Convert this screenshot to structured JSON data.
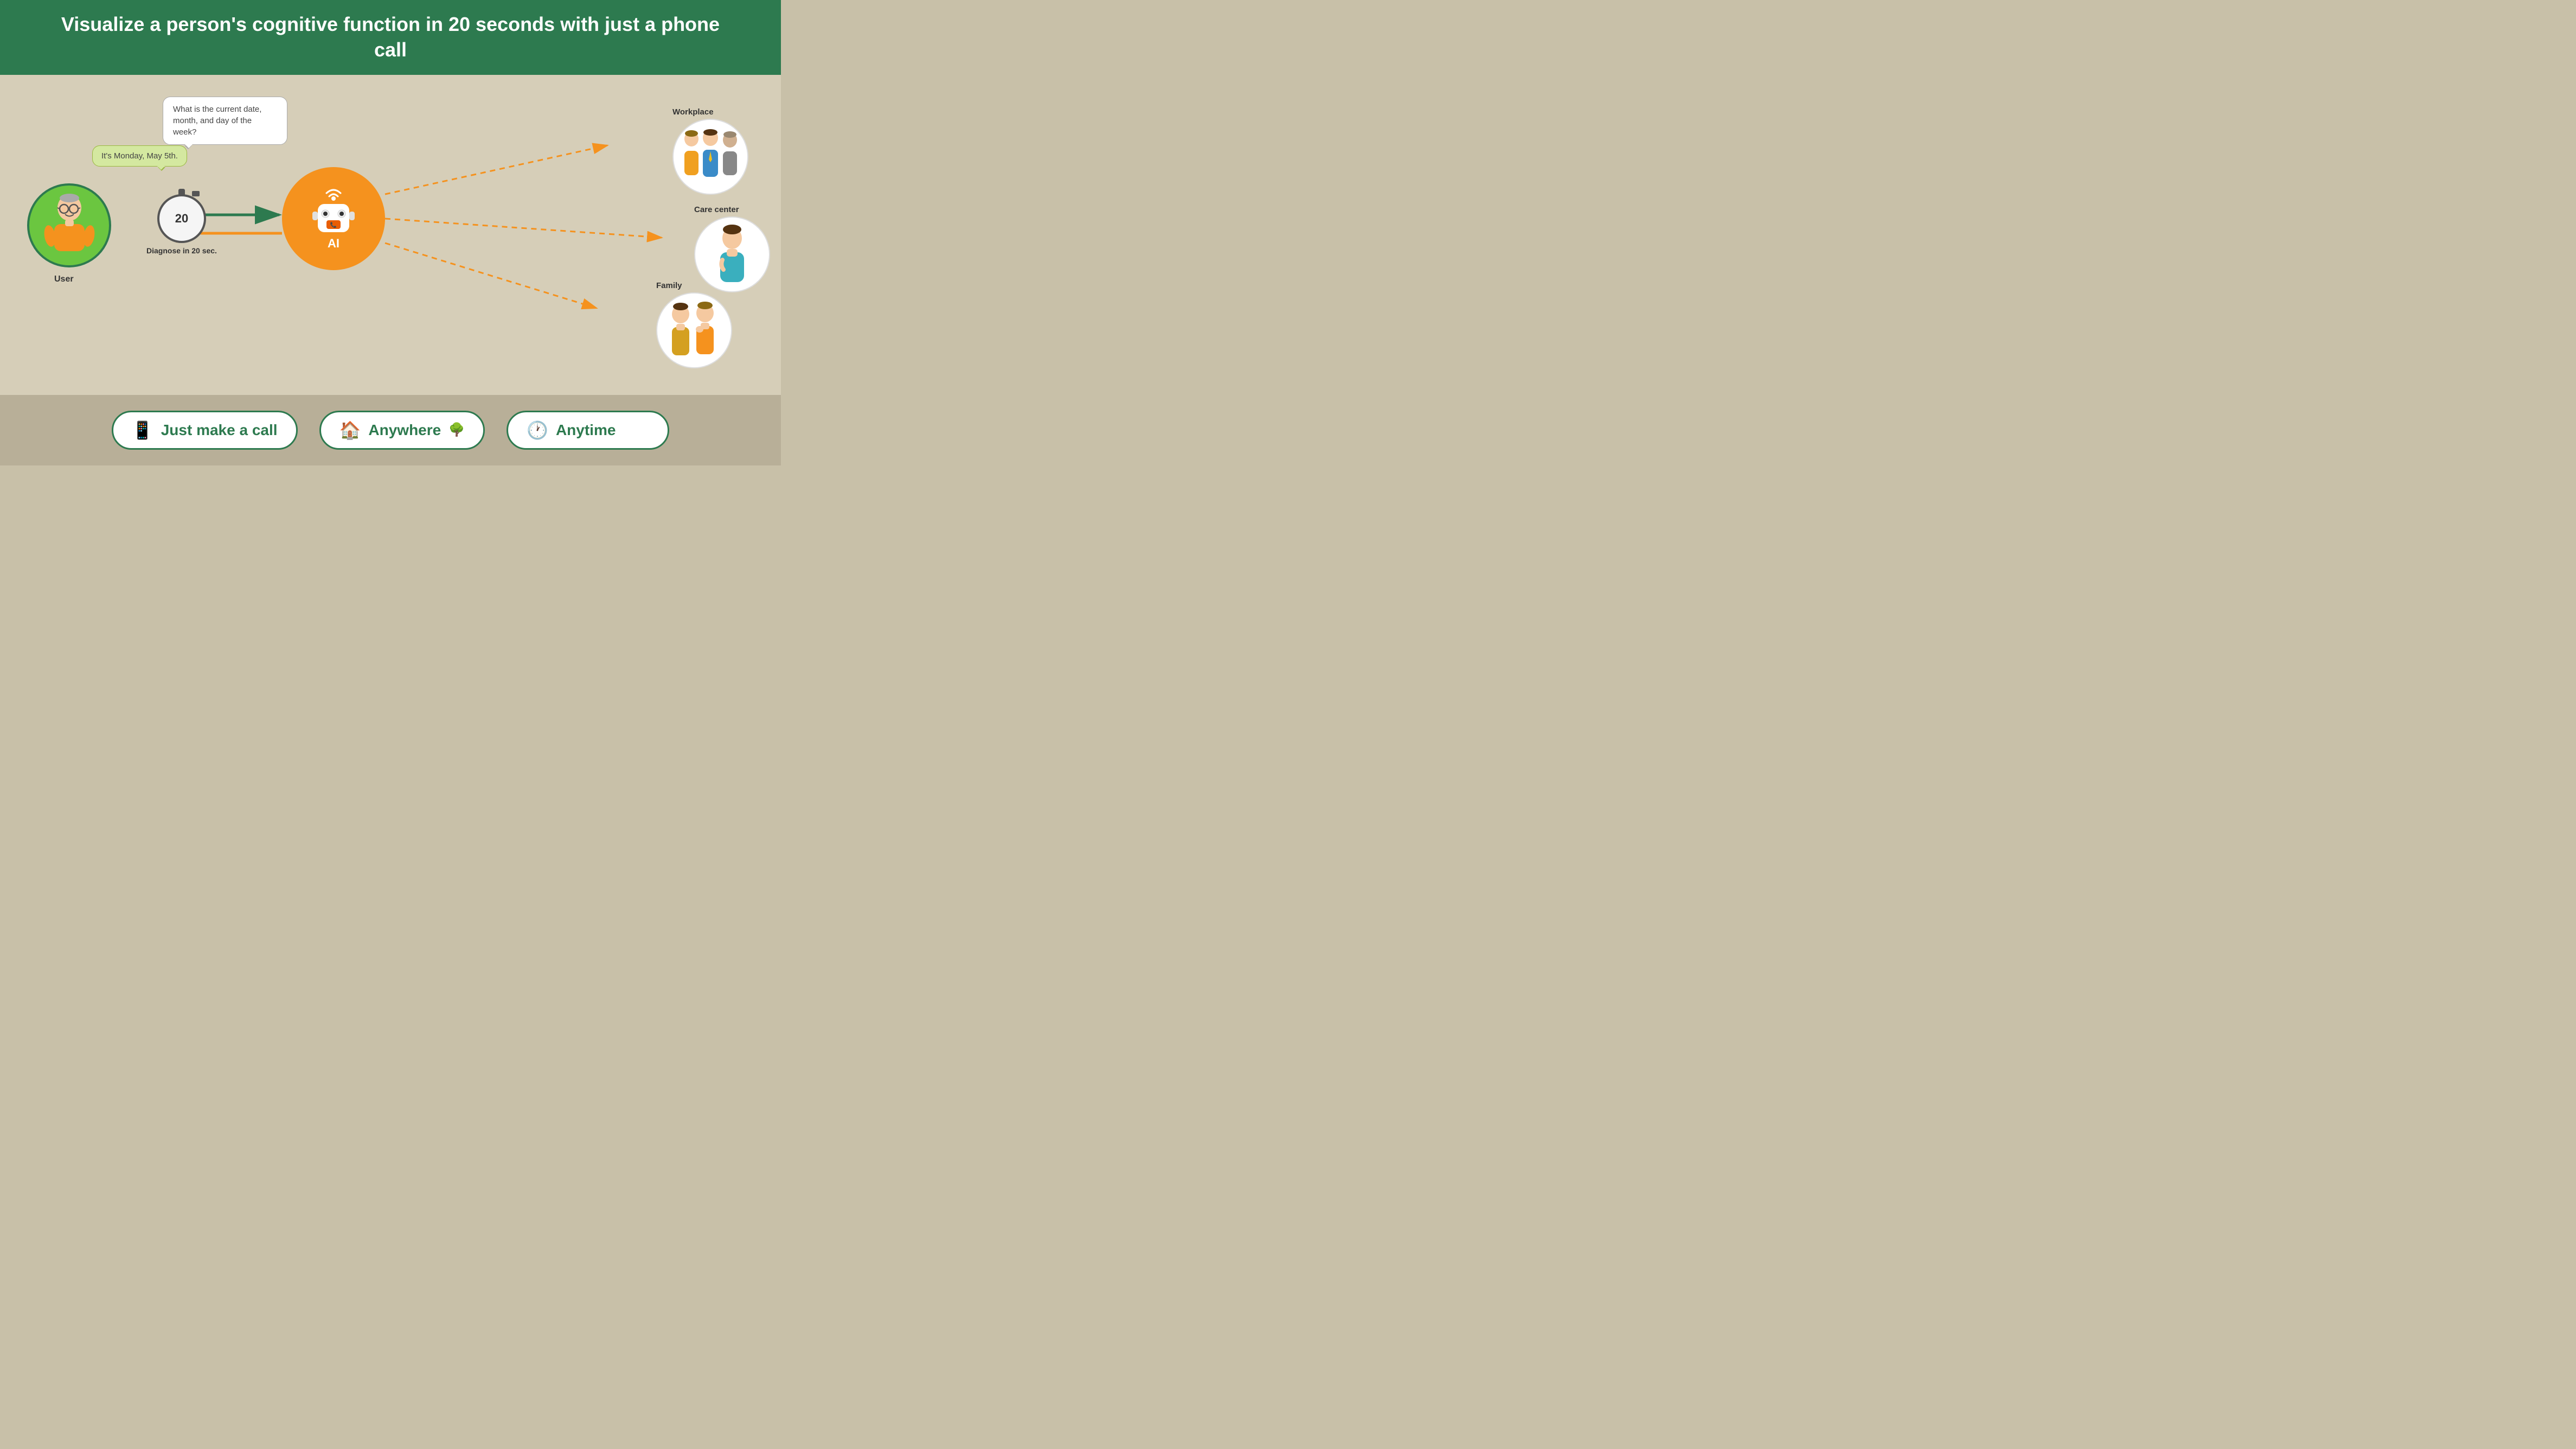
{
  "header": {
    "title": "Visualize a person's cognitive function in 20 seconds with just a phone call",
    "bg_color": "#2d7a4f"
  },
  "main": {
    "bg_color": "#d6ceb8",
    "bubble_question": "What is the current date, month, and day of the week?",
    "bubble_answer": "It's Monday, May 5th.",
    "user_label": "User",
    "stopwatch_number": "20",
    "diagnose_label": "Diagnose in 20 sec.",
    "ai_label": "AI",
    "connections": [
      {
        "label": "Workplace"
      },
      {
        "label": "Care center"
      },
      {
        "label": "Family"
      }
    ]
  },
  "footer": {
    "items": [
      {
        "icon": "📱",
        "label": "Just make a call"
      },
      {
        "icon": "🏠",
        "label": "Anywhere"
      },
      {
        "icon": "🕐",
        "label": "Anytime"
      }
    ]
  }
}
